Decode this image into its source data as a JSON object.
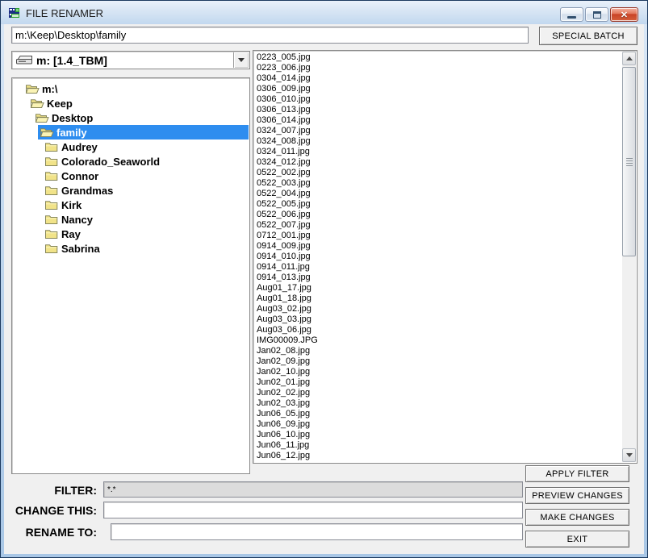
{
  "window": {
    "title": "FILE RENAMER"
  },
  "titlebar_controls": {
    "minimize": "minimize",
    "maximize": "maximize",
    "close": "close"
  },
  "toolbar": {
    "path_value": "m:\\Keep\\Desktop\\family",
    "special_batch_label": "SPECIAL BATCH"
  },
  "drive_combo": {
    "value": "m: [1.4_TBM]"
  },
  "folder_tree": {
    "items": [
      {
        "label": "m:\\",
        "level": 0,
        "icon": "open-folder",
        "selected": false
      },
      {
        "label": "Keep",
        "level": 1,
        "icon": "open-folder",
        "selected": false
      },
      {
        "label": "Desktop",
        "level": 2,
        "icon": "open-folder",
        "selected": false
      },
      {
        "label": "family",
        "level": 3,
        "icon": "open-folder",
        "selected": true
      },
      {
        "label": "Audrey",
        "level": 4,
        "icon": "closed-folder",
        "selected": false
      },
      {
        "label": "Colorado_Seaworld",
        "level": 4,
        "icon": "closed-folder",
        "selected": false
      },
      {
        "label": "Connor",
        "level": 4,
        "icon": "closed-folder",
        "selected": false
      },
      {
        "label": "Grandmas",
        "level": 4,
        "icon": "closed-folder",
        "selected": false
      },
      {
        "label": "Kirk",
        "level": 4,
        "icon": "closed-folder",
        "selected": false
      },
      {
        "label": "Nancy",
        "level": 4,
        "icon": "closed-folder",
        "selected": false
      },
      {
        "label": "Ray",
        "level": 4,
        "icon": "closed-folder",
        "selected": false
      },
      {
        "label": "Sabrina",
        "level": 4,
        "icon": "closed-folder",
        "selected": false
      }
    ]
  },
  "file_list": {
    "files": [
      "0223_005.jpg",
      "0223_006.jpg",
      "0304_014.jpg",
      "0306_009.jpg",
      "0306_010.jpg",
      "0306_013.jpg",
      "0306_014.jpg",
      "0324_007.jpg",
      "0324_008.jpg",
      "0324_011.jpg",
      "0324_012.jpg",
      "0522_002.jpg",
      "0522_003.jpg",
      "0522_004.jpg",
      "0522_005.jpg",
      "0522_006.jpg",
      "0522_007.jpg",
      "0712_001.jpg",
      "0914_009.jpg",
      "0914_010.jpg",
      "0914_011.jpg",
      "0914_013.jpg",
      "Aug01_17.jpg",
      "Aug01_18.jpg",
      "Aug03_02.jpg",
      "Aug03_03.jpg",
      "Aug03_06.jpg",
      "IMG00009.JPG",
      "Jan02_08.jpg",
      "Jan02_09.jpg",
      "Jan02_10.jpg",
      "Jun02_01.jpg",
      "Jun02_02.jpg",
      "Jun02_03.jpg",
      "Jun06_05.jpg",
      "Jun06_09.jpg",
      "Jun06_10.jpg",
      "Jun06_11.jpg",
      "Jun06_12.jpg"
    ]
  },
  "fields": {
    "filter": {
      "label": "FILTER:",
      "value": "*.*"
    },
    "change_this": {
      "label": "CHANGE THIS:",
      "value": ""
    },
    "rename_to": {
      "label": "RENAME TO:",
      "value": ""
    }
  },
  "action_buttons": {
    "apply_filter": "APPLY FILTER",
    "preview_changes": "PREVIEW CHANGES",
    "make_changes": "MAKE CHANGES",
    "exit": "EXIT"
  },
  "colors": {
    "selection_blue": "#2e8def",
    "close_button_red": "#c84226",
    "frame_blue": "#b6d0ea",
    "client_gray": "#f0f0f0",
    "filter_field_gray": "#dcdcdc",
    "folder_yellow": "#f1e389"
  }
}
